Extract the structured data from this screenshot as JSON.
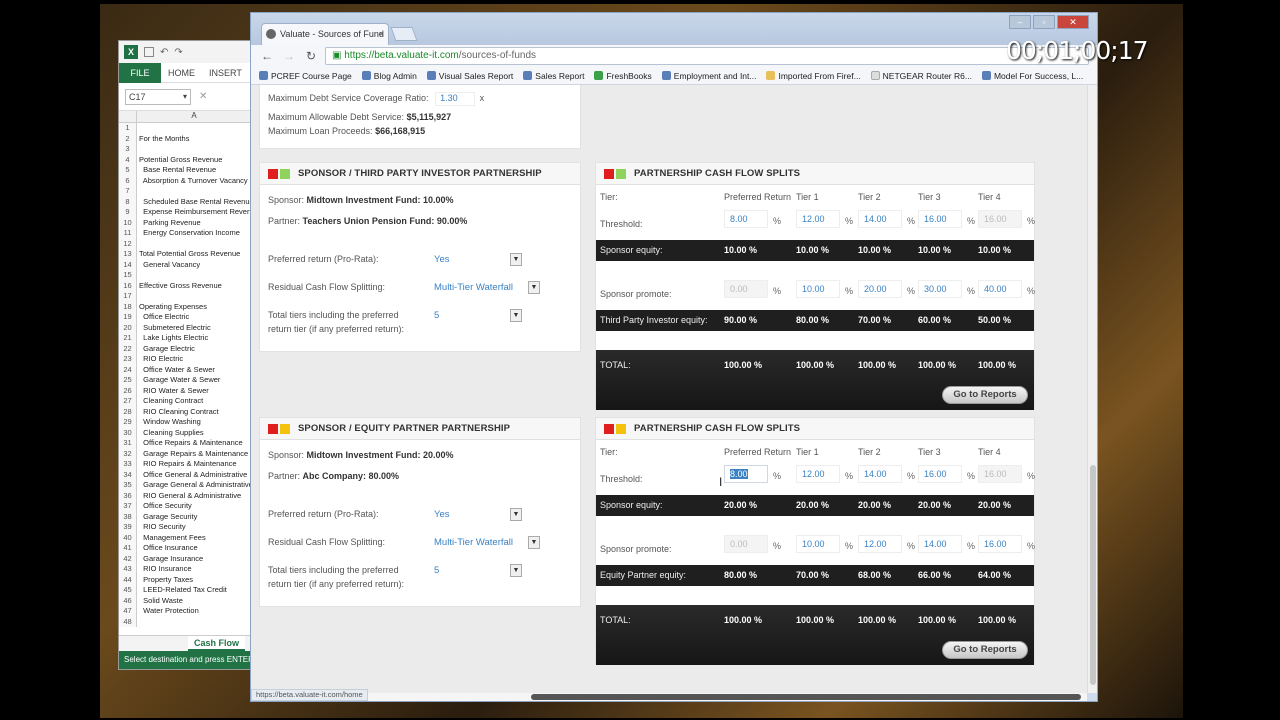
{
  "timecode": "00;01;00;17",
  "excel": {
    "file_tab": "FILE",
    "home_tab": "HOME",
    "insert_tab": "INSERT",
    "name_box": "C17",
    "column": "A",
    "rows": [
      {
        "n": "1",
        "t": ""
      },
      {
        "n": "2",
        "t": "For the Months"
      },
      {
        "n": "3",
        "t": ""
      },
      {
        "n": "4",
        "t": "Potential Gross Revenue"
      },
      {
        "n": "5",
        "t": "  Base Rental Revenue"
      },
      {
        "n": "6",
        "t": "  Absorption & Turnover Vacancy"
      },
      {
        "n": "7",
        "t": ""
      },
      {
        "n": "8",
        "t": "  Scheduled Base Rental Revenue"
      },
      {
        "n": "9",
        "t": "  Expense Reimbursement Revenue"
      },
      {
        "n": "10",
        "t": "  Parking Revenue"
      },
      {
        "n": "11",
        "t": "  Energy Conservation Income"
      },
      {
        "n": "12",
        "t": ""
      },
      {
        "n": "13",
        "t": "Total Potential Gross Revenue"
      },
      {
        "n": "14",
        "t": "  General Vacancy"
      },
      {
        "n": "15",
        "t": ""
      },
      {
        "n": "16",
        "t": "Effective Gross Revenue"
      },
      {
        "n": "17",
        "t": ""
      },
      {
        "n": "18",
        "t": "Operating Expenses"
      },
      {
        "n": "19",
        "t": "  Office Electric"
      },
      {
        "n": "20",
        "t": "  Submetered Electric"
      },
      {
        "n": "21",
        "t": "  Lake Lights Electric"
      },
      {
        "n": "22",
        "t": "  Garage Electric"
      },
      {
        "n": "23",
        "t": "  RIO Electric"
      },
      {
        "n": "24",
        "t": "  Office Water & Sewer"
      },
      {
        "n": "25",
        "t": "  Garage Water & Sewer"
      },
      {
        "n": "26",
        "t": "  RIO Water & Sewer"
      },
      {
        "n": "27",
        "t": "  Cleaning Contract"
      },
      {
        "n": "28",
        "t": "  RIO Cleaning Contract"
      },
      {
        "n": "29",
        "t": "  Window Washing"
      },
      {
        "n": "30",
        "t": "  Cleaning Supplies"
      },
      {
        "n": "31",
        "t": "  Office Repairs & Maintenance"
      },
      {
        "n": "32",
        "t": "  Garage Repairs & Maintenance"
      },
      {
        "n": "33",
        "t": "  RIO Repairs & Maintenance"
      },
      {
        "n": "34",
        "t": "  Office General & Administrative"
      },
      {
        "n": "35",
        "t": "  Garage General & Administrative"
      },
      {
        "n": "36",
        "t": "  RIO General & Administrative"
      },
      {
        "n": "37",
        "t": "  Office Security"
      },
      {
        "n": "38",
        "t": "  Garage Security"
      },
      {
        "n": "39",
        "t": "  RIO Security"
      },
      {
        "n": "40",
        "t": "  Management Fees"
      },
      {
        "n": "41",
        "t": "  Office Insurance"
      },
      {
        "n": "42",
        "t": "  Garage Insurance"
      },
      {
        "n": "43",
        "t": "  RIO Insurance"
      },
      {
        "n": "44",
        "t": "  Property Taxes"
      },
      {
        "n": "45",
        "t": "  LEED-Related Tax Credit"
      },
      {
        "n": "46",
        "t": "  Solid Waste"
      },
      {
        "n": "47",
        "t": "  Water Protection"
      },
      {
        "n": "48",
        "t": ""
      }
    ],
    "sheet_tab": "Cash Flow",
    "status": "Select destination and press ENTER"
  },
  "browser": {
    "tab_title": "Valuate - Sources of Fund",
    "url_host": "https://beta.valuate-it.com",
    "url_path": "/sources-of-funds",
    "bookmarks": [
      "PCREF Course Page",
      "Blog Admin",
      "Visual Sales Report",
      "Sales Report",
      "FreshBooks",
      "Employment and Int...",
      "Imported From Firef...",
      "NETGEAR Router R6...",
      "Model For Success, L..."
    ],
    "status_url": "https://beta.valuate-it.com/home"
  },
  "debt": {
    "dscr_label": "Maximum Debt Service Coverage Ratio:",
    "dscr_value": "1.30",
    "dscr_unit": "x",
    "ads_label": "Maximum Allowable Debt Service:",
    "ads_value": "$5,115,927",
    "mlp_label": "Maximum Loan Proceeds:",
    "mlp_value": "$66,168,915"
  },
  "p1": {
    "title": "SPONSOR / THIRD PARTY INVESTOR PARTNERSHIP",
    "sponsor_label": "Sponsor:",
    "sponsor_value": "Midtown Investment Fund: 10.00%",
    "partner_label": "Partner:",
    "partner_value": "Teachers Union Pension Fund: 90.00%",
    "pref_label": "Preferred return (Pro-Rata):",
    "pref_value": "Yes",
    "resid_label": "Residual Cash Flow Splitting:",
    "resid_value": "Multi-Tier Waterfall",
    "tiers_label_1": "Total tiers including the preferred",
    "tiers_label_2": "return tier (if any preferred return):",
    "tiers_value": "5"
  },
  "p2": {
    "title": "SPONSOR / EQUITY PARTNER PARTNERSHIP",
    "sponsor_label": "Sponsor:",
    "sponsor_value": "Midtown Investment Fund: 20.00%",
    "partner_label": "Partner:",
    "partner_value": "Abc Company: 80.00%",
    "pref_label": "Preferred return (Pro-Rata):",
    "pref_value": "Yes",
    "resid_label": "Residual Cash Flow Splitting:",
    "resid_value": "Multi-Tier Waterfall",
    "tiers_label_1": "Total tiers including the preferred",
    "tiers_label_2": "return tier (if any preferred return):",
    "tiers_value": "5"
  },
  "s1": {
    "title": "PARTNERSHIP CASH FLOW SPLITS",
    "headers": [
      "Tier:",
      "Preferred Return",
      "Tier 1",
      "Tier 2",
      "Tier 3",
      "Tier 4"
    ],
    "threshold_label": "Threshold:",
    "threshold": [
      "8.00",
      "12.00",
      "14.00",
      "16.00",
      "16.00"
    ],
    "sponsor_eq_label": "Sponsor equity:",
    "sponsor_eq": [
      "10.00 %",
      "10.00 %",
      "10.00 %",
      "10.00 %",
      "10.00 %"
    ],
    "promote_label": "Sponsor promote:",
    "promote": [
      "0.00",
      "10.00",
      "20.00",
      "30.00",
      "40.00"
    ],
    "partner_eq_label": "Third Party Investor equity:",
    "partner_eq": [
      "90.00 %",
      "80.00 %",
      "70.00 %",
      "60.00 %",
      "50.00 %"
    ],
    "total_label": "TOTAL:",
    "total": [
      "100.00 %",
      "100.00 %",
      "100.00 %",
      "100.00 %",
      "100.00 %"
    ],
    "button": "Go to Reports",
    "pct": "%"
  },
  "s2": {
    "title": "PARTNERSHIP CASH FLOW SPLITS",
    "headers": [
      "Tier:",
      "Preferred Return",
      "Tier 1",
      "Tier 2",
      "Tier 3",
      "Tier 4"
    ],
    "threshold_label": "Threshold:",
    "threshold": [
      "8.00",
      "12.00",
      "14.00",
      "16.00",
      "16.00"
    ],
    "sponsor_eq_label": "Sponsor equity:",
    "sponsor_eq": [
      "20.00 %",
      "20.00 %",
      "20.00 %",
      "20.00 %",
      "20.00 %"
    ],
    "promote_label": "Sponsor promote:",
    "promote": [
      "0.00",
      "10.00",
      "12.00",
      "14.00",
      "16.00"
    ],
    "partner_eq_label": "Equity Partner equity:",
    "partner_eq": [
      "80.00 %",
      "70.00 %",
      "68.00 %",
      "66.00 %",
      "64.00 %"
    ],
    "total_label": "TOTAL:",
    "total": [
      "100.00 %",
      "100.00 %",
      "100.00 %",
      "100.00 %",
      "100.00 %"
    ],
    "button": "Go to Reports",
    "pct": "%"
  },
  "colors": {
    "red": "#e01e1e",
    "green": "#8fd45a",
    "yellow": "#f4c20d",
    "link": "#3a82c4",
    "excel": "#217346"
  }
}
